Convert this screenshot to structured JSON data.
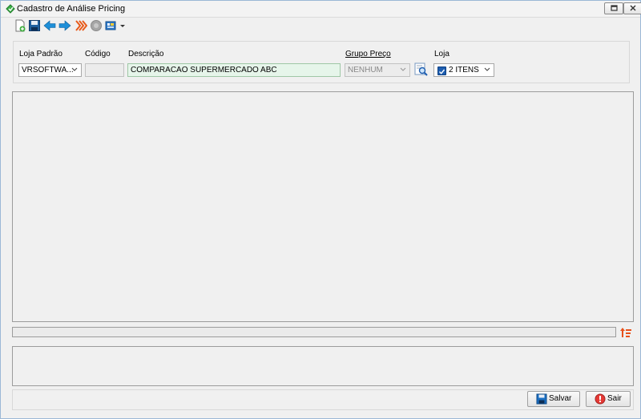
{
  "window": {
    "title": "Cadastro de Análise Pricing"
  },
  "toolbar": {
    "icons": [
      "new-icon",
      "save-disk-icon",
      "back-arrow-icon",
      "forward-arrow-icon",
      "fast-forward-icon",
      "disabled-circle-icon",
      "export-dropdown-icon"
    ]
  },
  "form": {
    "loja_padrao": {
      "label": "Loja Padrão",
      "value": "VRSOFTWA..."
    },
    "codigo": {
      "label": "Código",
      "value": ""
    },
    "descricao": {
      "label": "Descrição",
      "value": "COMPARACAO SUPERMERCADO ABC"
    },
    "grupo_preco": {
      "label": "Grupo Preço",
      "value": "NENHUM"
    },
    "loja": {
      "label": "Loja",
      "value": "2 ITENS"
    }
  },
  "footer": {
    "save_label": "Salvar",
    "exit_label": "Sair"
  },
  "colors": {
    "accent": "#1e5eb0",
    "description_bg": "#e6f5ea",
    "save_blue": "#1a6fc4",
    "exit_red": "#e53935"
  }
}
